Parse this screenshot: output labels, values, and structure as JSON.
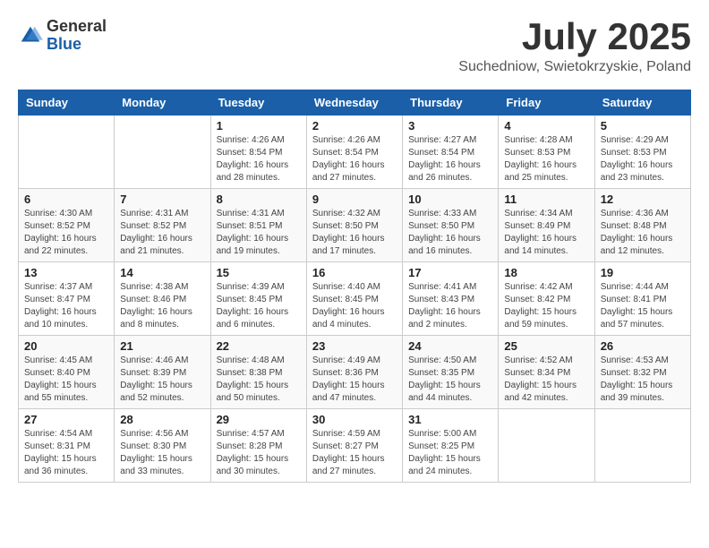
{
  "logo": {
    "general": "General",
    "blue": "Blue"
  },
  "title": {
    "month_year": "July 2025",
    "location": "Suchedniow, Swietokrzyskie, Poland"
  },
  "weekdays": [
    "Sunday",
    "Monday",
    "Tuesday",
    "Wednesday",
    "Thursday",
    "Friday",
    "Saturday"
  ],
  "weeks": [
    [
      {
        "day": "",
        "sunrise": "",
        "sunset": "",
        "daylight": ""
      },
      {
        "day": "",
        "sunrise": "",
        "sunset": "",
        "daylight": ""
      },
      {
        "day": "1",
        "sunrise": "Sunrise: 4:26 AM",
        "sunset": "Sunset: 8:54 PM",
        "daylight": "Daylight: 16 hours and 28 minutes."
      },
      {
        "day": "2",
        "sunrise": "Sunrise: 4:26 AM",
        "sunset": "Sunset: 8:54 PM",
        "daylight": "Daylight: 16 hours and 27 minutes."
      },
      {
        "day": "3",
        "sunrise": "Sunrise: 4:27 AM",
        "sunset": "Sunset: 8:54 PM",
        "daylight": "Daylight: 16 hours and 26 minutes."
      },
      {
        "day": "4",
        "sunrise": "Sunrise: 4:28 AM",
        "sunset": "Sunset: 8:53 PM",
        "daylight": "Daylight: 16 hours and 25 minutes."
      },
      {
        "day": "5",
        "sunrise": "Sunrise: 4:29 AM",
        "sunset": "Sunset: 8:53 PM",
        "daylight": "Daylight: 16 hours and 23 minutes."
      }
    ],
    [
      {
        "day": "6",
        "sunrise": "Sunrise: 4:30 AM",
        "sunset": "Sunset: 8:52 PM",
        "daylight": "Daylight: 16 hours and 22 minutes."
      },
      {
        "day": "7",
        "sunrise": "Sunrise: 4:31 AM",
        "sunset": "Sunset: 8:52 PM",
        "daylight": "Daylight: 16 hours and 21 minutes."
      },
      {
        "day": "8",
        "sunrise": "Sunrise: 4:31 AM",
        "sunset": "Sunset: 8:51 PM",
        "daylight": "Daylight: 16 hours and 19 minutes."
      },
      {
        "day": "9",
        "sunrise": "Sunrise: 4:32 AM",
        "sunset": "Sunset: 8:50 PM",
        "daylight": "Daylight: 16 hours and 17 minutes."
      },
      {
        "day": "10",
        "sunrise": "Sunrise: 4:33 AM",
        "sunset": "Sunset: 8:50 PM",
        "daylight": "Daylight: 16 hours and 16 minutes."
      },
      {
        "day": "11",
        "sunrise": "Sunrise: 4:34 AM",
        "sunset": "Sunset: 8:49 PM",
        "daylight": "Daylight: 16 hours and 14 minutes."
      },
      {
        "day": "12",
        "sunrise": "Sunrise: 4:36 AM",
        "sunset": "Sunset: 8:48 PM",
        "daylight": "Daylight: 16 hours and 12 minutes."
      }
    ],
    [
      {
        "day": "13",
        "sunrise": "Sunrise: 4:37 AM",
        "sunset": "Sunset: 8:47 PM",
        "daylight": "Daylight: 16 hours and 10 minutes."
      },
      {
        "day": "14",
        "sunrise": "Sunrise: 4:38 AM",
        "sunset": "Sunset: 8:46 PM",
        "daylight": "Daylight: 16 hours and 8 minutes."
      },
      {
        "day": "15",
        "sunrise": "Sunrise: 4:39 AM",
        "sunset": "Sunset: 8:45 PM",
        "daylight": "Daylight: 16 hours and 6 minutes."
      },
      {
        "day": "16",
        "sunrise": "Sunrise: 4:40 AM",
        "sunset": "Sunset: 8:45 PM",
        "daylight": "Daylight: 16 hours and 4 minutes."
      },
      {
        "day": "17",
        "sunrise": "Sunrise: 4:41 AM",
        "sunset": "Sunset: 8:43 PM",
        "daylight": "Daylight: 16 hours and 2 minutes."
      },
      {
        "day": "18",
        "sunrise": "Sunrise: 4:42 AM",
        "sunset": "Sunset: 8:42 PM",
        "daylight": "Daylight: 15 hours and 59 minutes."
      },
      {
        "day": "19",
        "sunrise": "Sunrise: 4:44 AM",
        "sunset": "Sunset: 8:41 PM",
        "daylight": "Daylight: 15 hours and 57 minutes."
      }
    ],
    [
      {
        "day": "20",
        "sunrise": "Sunrise: 4:45 AM",
        "sunset": "Sunset: 8:40 PM",
        "daylight": "Daylight: 15 hours and 55 minutes."
      },
      {
        "day": "21",
        "sunrise": "Sunrise: 4:46 AM",
        "sunset": "Sunset: 8:39 PM",
        "daylight": "Daylight: 15 hours and 52 minutes."
      },
      {
        "day": "22",
        "sunrise": "Sunrise: 4:48 AM",
        "sunset": "Sunset: 8:38 PM",
        "daylight": "Daylight: 15 hours and 50 minutes."
      },
      {
        "day": "23",
        "sunrise": "Sunrise: 4:49 AM",
        "sunset": "Sunset: 8:36 PM",
        "daylight": "Daylight: 15 hours and 47 minutes."
      },
      {
        "day": "24",
        "sunrise": "Sunrise: 4:50 AM",
        "sunset": "Sunset: 8:35 PM",
        "daylight": "Daylight: 15 hours and 44 minutes."
      },
      {
        "day": "25",
        "sunrise": "Sunrise: 4:52 AM",
        "sunset": "Sunset: 8:34 PM",
        "daylight": "Daylight: 15 hours and 42 minutes."
      },
      {
        "day": "26",
        "sunrise": "Sunrise: 4:53 AM",
        "sunset": "Sunset: 8:32 PM",
        "daylight": "Daylight: 15 hours and 39 minutes."
      }
    ],
    [
      {
        "day": "27",
        "sunrise": "Sunrise: 4:54 AM",
        "sunset": "Sunset: 8:31 PM",
        "daylight": "Daylight: 15 hours and 36 minutes."
      },
      {
        "day": "28",
        "sunrise": "Sunrise: 4:56 AM",
        "sunset": "Sunset: 8:30 PM",
        "daylight": "Daylight: 15 hours and 33 minutes."
      },
      {
        "day": "29",
        "sunrise": "Sunrise: 4:57 AM",
        "sunset": "Sunset: 8:28 PM",
        "daylight": "Daylight: 15 hours and 30 minutes."
      },
      {
        "day": "30",
        "sunrise": "Sunrise: 4:59 AM",
        "sunset": "Sunset: 8:27 PM",
        "daylight": "Daylight: 15 hours and 27 minutes."
      },
      {
        "day": "31",
        "sunrise": "Sunrise: 5:00 AM",
        "sunset": "Sunset: 8:25 PM",
        "daylight": "Daylight: 15 hours and 24 minutes."
      },
      {
        "day": "",
        "sunrise": "",
        "sunset": "",
        "daylight": ""
      },
      {
        "day": "",
        "sunrise": "",
        "sunset": "",
        "daylight": ""
      }
    ]
  ]
}
